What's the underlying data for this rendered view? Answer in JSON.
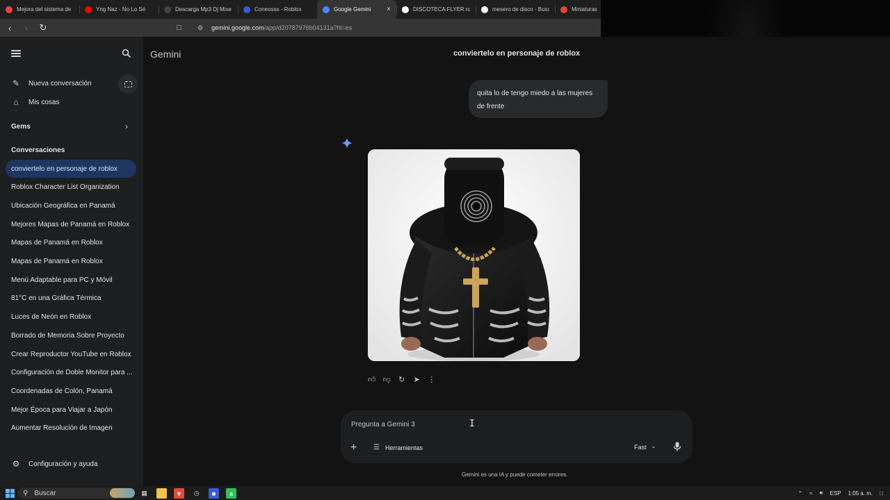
{
  "browser": {
    "tabs": [
      {
        "title": "Mejora del sistema de",
        "icon": "puzzle-icon",
        "color": "#e8453c",
        "active": false
      },
      {
        "title": "Yng Naz - No Lo Sé",
        "icon": "youtube-icon",
        "color": "#ff0000",
        "active": false
      },
      {
        "title": "Descarga Mp3 Dj Mixe",
        "icon": "music-icon",
        "color": "#444444",
        "active": false
      },
      {
        "title": "Coneosss - Roblox",
        "icon": "roblox-icon",
        "color": "#3a5bd9",
        "active": false
      },
      {
        "title": "Google Gemini",
        "icon": "gemini-icon",
        "color": "#4e86f7",
        "active": true
      },
      {
        "title": "DISCOTECA FLYER robl",
        "icon": "google-icon",
        "color": "#ffffff",
        "active": false
      },
      {
        "title": "mesero de disco - Busc",
        "icon": "google-icon",
        "color": "#ffffff",
        "active": false
      },
      {
        "title": "Miniaturas",
        "icon": "red-icon",
        "color": "#e8453c",
        "active": false
      }
    ],
    "url_host": "gemini.google.com",
    "url_path": "/app/d20787976b04131a?hl=es"
  },
  "sidebar": {
    "new_chat": "Nueva conversación",
    "my_stuff": "Mis cosas",
    "gems": "Gems",
    "section_title": "Conversaciones",
    "conversations": [
      "conviertelo en personaje de roblox",
      "Roblox Character List Organization",
      "Ubicación Geográfica en Panamá",
      "Mejores Mapas de Panamá en Roblox",
      "Mapas de Panamá en Roblox",
      "Mapas de Panamá en Roblox",
      "Menú Adaptable para PC y Móvil",
      "81°C en una Gráfica Térmica",
      "Luces de Neón en Roblox",
      "Borrado de Memoria Sobre Proyecto",
      "Crear Reproductor YouTube en Roblox",
      "Configuración de Doble Monitor para ...",
      "Coordenadas de Colón, Panamá",
      "Mejor Época para Viajar a Japón",
      "Aumentar Resolución de Imagen"
    ],
    "settings": "Configuración y ayuda"
  },
  "main": {
    "brand": "Gemini",
    "chat_title": "conviertelo en personaje de roblox",
    "user_message": "quita lo de tengo miedo a las mujeres de frente",
    "composer_placeholder": "Pregunta a Gemini 3",
    "tools_label": "Herramientas",
    "mode_label": "Fast",
    "disclaimer": "Gemini es una IA y puede cometer errores."
  },
  "taskbar": {
    "search_label": "Buscar",
    "lang": "ESP",
    "time": "1:05 a. m."
  },
  "colors": {
    "sidebar_bg": "#1e1f20",
    "main_bg": "#131314",
    "active_item": "#1f3760",
    "gemini_blue": "#4e86f7"
  }
}
